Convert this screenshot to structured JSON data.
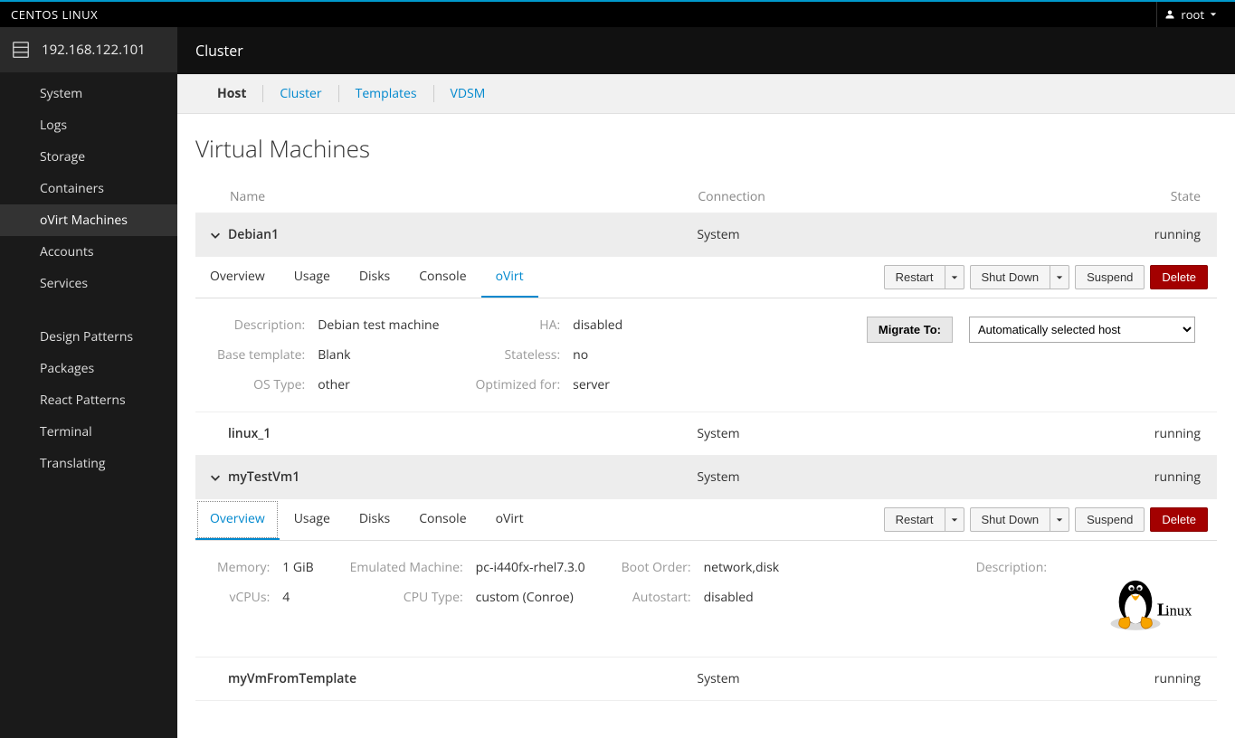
{
  "brand": "CENTOS LINUX",
  "user": "root",
  "host": "192.168.122.101",
  "sidebar": {
    "items": [
      {
        "label": "System",
        "active": false
      },
      {
        "label": "Logs",
        "active": false
      },
      {
        "label": "Storage",
        "active": false
      },
      {
        "label": "Containers",
        "active": false
      },
      {
        "label": "oVirt Machines",
        "active": true
      },
      {
        "label": "Accounts",
        "active": false
      },
      {
        "label": "Services",
        "active": false
      }
    ],
    "items2": [
      {
        "label": "Design Patterns"
      },
      {
        "label": "Packages"
      },
      {
        "label": "React Patterns"
      },
      {
        "label": "Terminal"
      },
      {
        "label": "Translating"
      }
    ]
  },
  "crumb": "Cluster",
  "sub_tabs": [
    {
      "label": "Host",
      "active": true
    },
    {
      "label": "Cluster",
      "active": false
    },
    {
      "label": "Templates",
      "active": false
    },
    {
      "label": "VDSM",
      "active": false
    }
  ],
  "page_title": "Virtual Machines",
  "columns": {
    "name": "Name",
    "connection": "Connection",
    "state": "State"
  },
  "vm_tabs": [
    "Overview",
    "Usage",
    "Disks",
    "Console",
    "oVirt"
  ],
  "actions": {
    "restart": "Restart",
    "shutdown": "Shut Down",
    "suspend": "Suspend",
    "delete": "Delete"
  },
  "migrate": {
    "button": "Migrate To:",
    "selected": "Automatically selected host"
  },
  "vms": [
    {
      "name": "Debian1",
      "connection": "System",
      "state": "running",
      "expanded": true,
      "active_tab": "oVirt",
      "ovirt_details": {
        "left": [
          {
            "label": "Description:",
            "value": "Debian test machine"
          },
          {
            "label": "Base template:",
            "value": "Blank"
          },
          {
            "label": "OS Type:",
            "value": "other"
          }
        ],
        "right": [
          {
            "label": "HA:",
            "value": "disabled"
          },
          {
            "label": "Stateless:",
            "value": "no"
          },
          {
            "label": "Optimized for:",
            "value": "server"
          }
        ]
      }
    },
    {
      "name": "linux_1",
      "connection": "System",
      "state": "running",
      "expanded": false
    },
    {
      "name": "myTestVm1",
      "connection": "System",
      "state": "running",
      "expanded": true,
      "active_tab": "Overview",
      "active_dotted": true,
      "overview": {
        "c1": [
          {
            "label": "Memory:",
            "value": "1 GiB"
          },
          {
            "label": "vCPUs:",
            "value": "4"
          }
        ],
        "c2": [
          {
            "label": "Emulated Machine:",
            "value": "pc-i440fx-rhel7.3.0"
          },
          {
            "label": "CPU Type:",
            "value": "custom (Conroe)"
          }
        ],
        "c3": [
          {
            "label": "Boot Order:",
            "value": "network,disk"
          },
          {
            "label": "Autostart:",
            "value": "disabled"
          }
        ],
        "desc_label": "Description:"
      }
    },
    {
      "name": "myVmFromTemplate",
      "connection": "System",
      "state": "running",
      "expanded": false
    }
  ]
}
